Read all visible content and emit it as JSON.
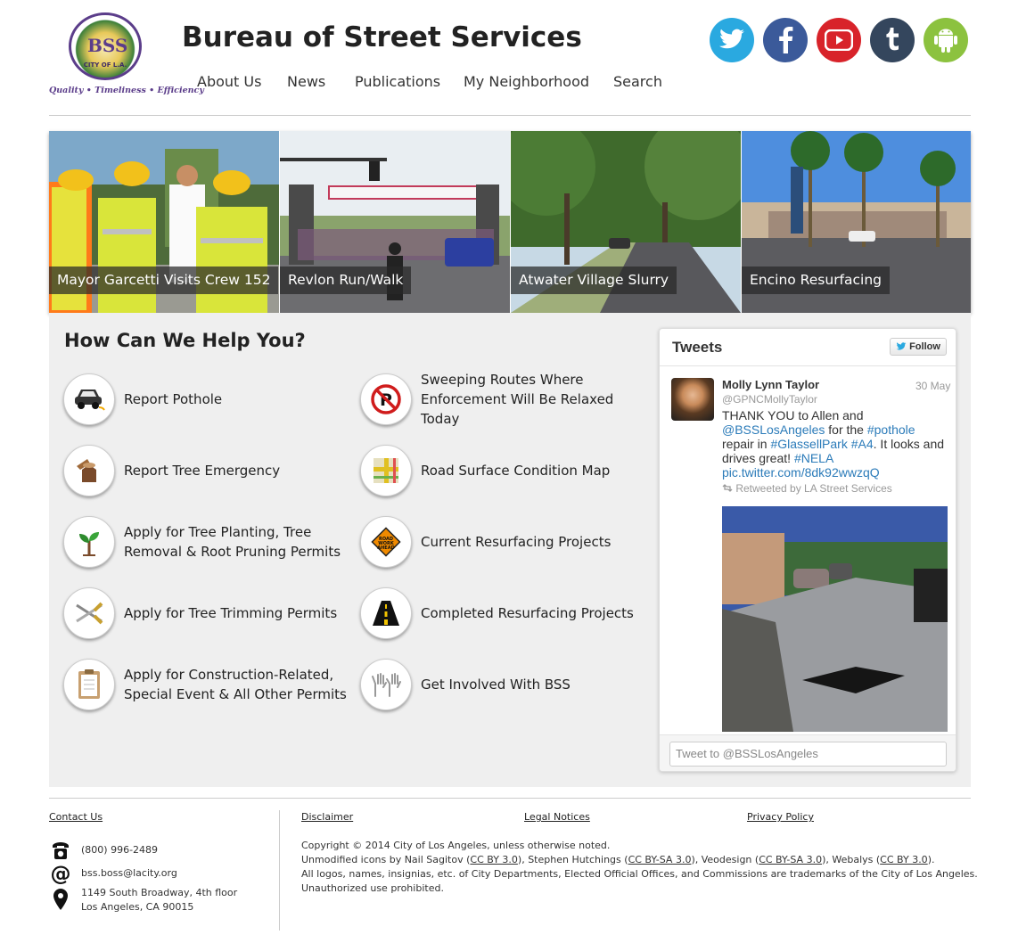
{
  "header": {
    "logo_text": {
      "seal": "BSS",
      "city": "CITY OF L.A.",
      "tagline": "Quality • Timeliness • Efficiency"
    },
    "title": "Bureau of Street Services",
    "nav": [
      "About Us",
      "News",
      "Publications",
      "My Neighborhood",
      "Search"
    ],
    "social": [
      {
        "name": "twitter",
        "color": "#2aa9e0"
      },
      {
        "name": "facebook",
        "color": "#3b5a9a"
      },
      {
        "name": "youtube",
        "color": "#d8232a"
      },
      {
        "name": "tumblr",
        "color": "#34465d"
      },
      {
        "name": "android",
        "color": "#8cc23f"
      }
    ]
  },
  "slider": {
    "slides": [
      {
        "caption": "Mayor Garcetti Visits Crew 152"
      },
      {
        "caption": "Revlon Run/Walk"
      },
      {
        "caption": "Atwater Village Slurry"
      },
      {
        "caption": "Encino Resurfacing"
      }
    ]
  },
  "help": {
    "title": "How Can We Help You?",
    "items": [
      {
        "label_lines": [
          "Report Pothole"
        ],
        "icon": "pothole-car-icon"
      },
      {
        "label_lines": [
          "Sweeping Routes Where",
          "Enforcement Will Be Relaxed Today"
        ],
        "icon": "no-parking-icon"
      },
      {
        "label_lines": [
          "Report Tree Emergency"
        ],
        "icon": "tree-stump-icon"
      },
      {
        "label_lines": [
          "Road Surface Condition Map"
        ],
        "icon": "map-icon"
      },
      {
        "label_lines": [
          "Apply for Tree Planting, Tree",
          "Removal & Root Pruning Permits"
        ],
        "icon": "sapling-icon"
      },
      {
        "label_lines": [
          "Current Resurfacing Projects"
        ],
        "icon": "road-work-sign-icon"
      },
      {
        "label_lines": [
          "Apply for Tree Trimming Permits"
        ],
        "icon": "pruning-shears-icon"
      },
      {
        "label_lines": [
          "Completed Resurfacing Projects"
        ],
        "icon": "road-icon"
      },
      {
        "label_lines": [
          "Apply for Construction-Related,",
          "Special Event & All Other Permits"
        ],
        "icon": "clipboard-icon"
      },
      {
        "label_lines": [
          "Get Involved With BSS"
        ],
        "icon": "raised-hands-icon"
      }
    ]
  },
  "tweets": {
    "title": "Tweets",
    "follow_label": "Follow",
    "tweet": {
      "name": "Molly Lynn Taylor",
      "handle": "@GPNCMollyTaylor",
      "date": "30 May",
      "text_parts": [
        {
          "t": "THANK YOU to Allen and ",
          "link": false
        },
        {
          "t": "@BSSLosAngeles",
          "link": true
        },
        {
          "t": " for the ",
          "link": false
        },
        {
          "t": "#pothole",
          "link": true
        },
        {
          "t": " repair in ",
          "link": false
        },
        {
          "t": "#GlassellPark",
          "link": true
        },
        {
          "t": " ",
          "link": false
        },
        {
          "t": "#A4",
          "link": true
        },
        {
          "t": ". It looks and drives great! ",
          "link": false
        },
        {
          "t": "#NELA",
          "link": true
        },
        {
          "t": " ",
          "link": false
        },
        {
          "t": "pic.twitter.com/8dk92wwzqQ",
          "link": true
        }
      ],
      "retweeted_by": "Retweeted by LA Street Services"
    },
    "compose_placeholder": "Tweet to @BSSLosAngeles"
  },
  "footer": {
    "contact_us": "Contact Us",
    "phone": "(800) 996-2489",
    "email": "bss.boss@lacity.org",
    "address_line1": "1149 South Broadway, 4th floor",
    "address_line2": "Los Angeles, CA 90015",
    "links": [
      "Disclaimer",
      "Legal Notices",
      "Privacy Policy"
    ],
    "copyright": "Copyright © 2014 City of Los Angeles, unless otherwise noted.",
    "credits": {
      "prefix": "Unmodified icons by Nail Sagitov (",
      "l1": "CC BY 3.0",
      "mid1": "), Stephen Hutchings (",
      "l2": "CC BY-SA 3.0",
      "mid2": "), Veodesign (",
      "l3": "CC BY-SA 3.0",
      "mid3": "), Webalys (",
      "l4": "CC BY 3.0",
      "suffix": ")."
    },
    "trademark": "All logos, names, insignias, etc. of City Departments, Elected Official Offices, and Commissions are trademarks of the City of Los Angeles.",
    "unauthorized": "Unauthorized use prohibited."
  }
}
